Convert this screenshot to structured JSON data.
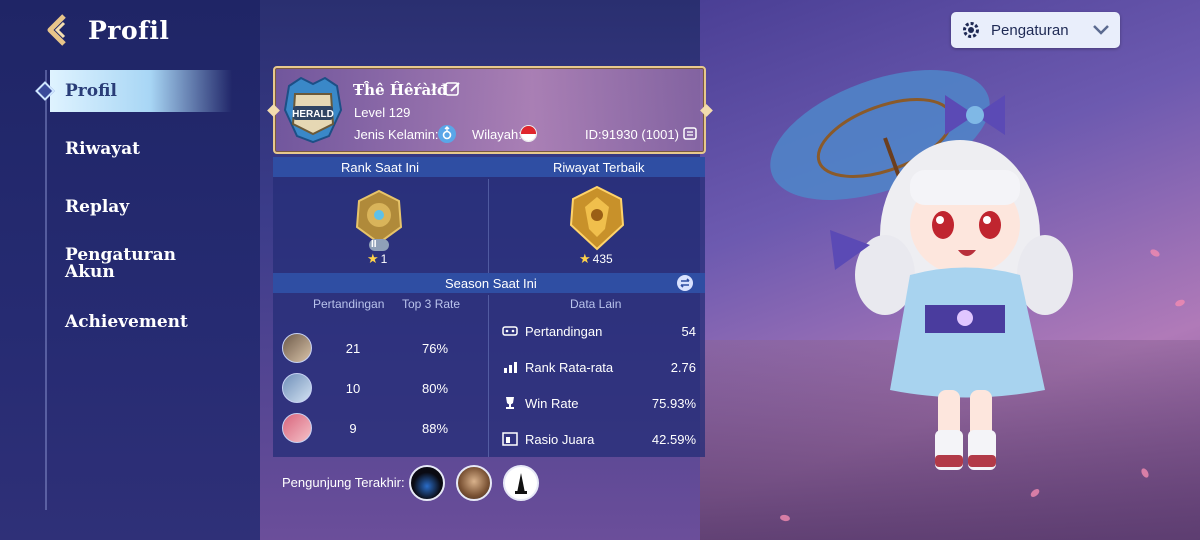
{
  "header": {
    "title": "Profil"
  },
  "settings": {
    "label": "Pengaturan"
  },
  "sidebar": {
    "items": [
      {
        "label": "Profil",
        "active": true
      },
      {
        "label": "Riwayat"
      },
      {
        "label": "Replay"
      },
      {
        "label": "Pengaturan Akun"
      },
      {
        "label": "Achievement"
      }
    ]
  },
  "profile": {
    "name": "Ŧĥê Ĥêŕàłđ",
    "level": "Level 129",
    "gender_label": "Jenis Kelamin:",
    "region_label": "Wilayah:",
    "id_text": "ID:91930 (1001)",
    "badge_text": "HERALD"
  },
  "rank": {
    "current_header": "Rank Saat Ini",
    "best_header": "Riwayat Terbaik",
    "current_tier": "II",
    "current_stars": "1",
    "best_stars": "435"
  },
  "season": {
    "header": "Season Saat Ini",
    "matches_header": "Pertandingan",
    "top3_header": "Top 3 Rate",
    "heroes": [
      {
        "matches": "21",
        "rate": "76%"
      },
      {
        "matches": "10",
        "rate": "80%"
      },
      {
        "matches": "9",
        "rate": "88%"
      }
    ],
    "other_header": "Data Lain",
    "other": [
      {
        "icon": "controller-icon",
        "label": "Pertandingan",
        "value": "54"
      },
      {
        "icon": "chart-icon",
        "label": "Rank Rata-rata",
        "value": "2.76"
      },
      {
        "icon": "trophy-icon",
        "label": "Win Rate",
        "value": "75.93%"
      },
      {
        "icon": "podium-icon",
        "label": "Rasio Juara",
        "value": "42.59%"
      }
    ]
  },
  "visitors": {
    "label": "Pengunjung Terakhir:"
  },
  "colors": {
    "accent": "#2f4ea3",
    "gold": "#e8c98d",
    "panel": "#262e78"
  }
}
